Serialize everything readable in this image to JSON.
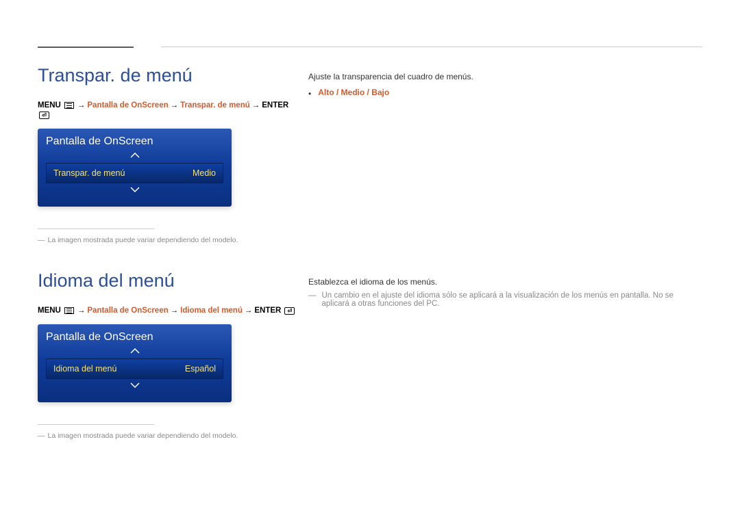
{
  "section1": {
    "heading": "Transpar. de menú",
    "breadcrumb": {
      "menu": "MENU",
      "path1": "Pantalla de OnScreen",
      "path2": "Transpar. de menú",
      "enter": "ENTER"
    },
    "panel": {
      "title": "Pantalla de OnScreen",
      "row_label": "Transpar. de menú",
      "row_value": "Medio"
    },
    "footnote": "La imagen mostrada puede variar dependiendo del modelo.",
    "right": {
      "desc": "Ajuste la transparencia del cuadro de menús.",
      "options": "Alto / Medio / Bajo"
    }
  },
  "section2": {
    "heading": "Idioma del menú",
    "breadcrumb": {
      "menu": "MENU",
      "path1": "Pantalla de OnScreen",
      "path2": "Idioma del menú",
      "enter": "ENTER"
    },
    "panel": {
      "title": "Pantalla de OnScreen",
      "row_label": "Idioma del menú",
      "row_value": "Español"
    },
    "footnote": "La imagen mostrada puede variar dependiendo del modelo.",
    "right": {
      "desc": "Establezca el idioma de los menús.",
      "note": "Un cambio en el ajuste del idioma sólo se aplicará a la visualización de los menús en pantalla. No se aplicará a otras funciones del PC."
    }
  }
}
